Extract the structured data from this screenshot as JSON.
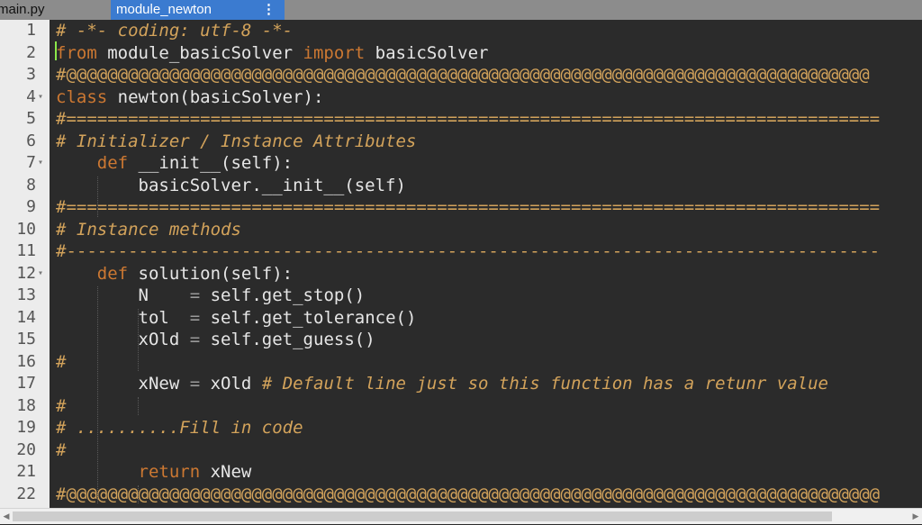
{
  "tabs": [
    {
      "label": "main.py",
      "active": false
    },
    {
      "label": "module_newton",
      "active": true
    }
  ],
  "tab_menu_icon": "⋮",
  "editor": {
    "lines": [
      {
        "n": "1",
        "fold": false,
        "tokens": [
          {
            "t": "# -*- coding: utf-8 -*-",
            "c": "cm"
          }
        ]
      },
      {
        "n": "2",
        "fold": false,
        "tokens": [
          {
            "t": "from",
            "c": "kw"
          },
          {
            "t": " module_basicSolver ",
            "c": ""
          },
          {
            "t": "import",
            "c": "kw"
          },
          {
            "t": " basicSolver",
            "c": ""
          }
        ]
      },
      {
        "n": "3",
        "fold": false,
        "tokens": [
          {
            "t": "#@@@@@@@@@@@@@@@@@@@@@@@@@@@@@@@@@@@@@@@@@@@@@@@@@@@@@@@@@@@@@@@@@@@@@@@@@@@@@@",
            "c": "cmn"
          }
        ]
      },
      {
        "n": "4",
        "fold": true,
        "tokens": [
          {
            "t": "class",
            "c": "kw"
          },
          {
            "t": " newton(basicSolver):",
            "c": ""
          }
        ]
      },
      {
        "n": "5",
        "fold": false,
        "tokens": [
          {
            "t": "#===============================================================================",
            "c": "cmn"
          }
        ]
      },
      {
        "n": "6",
        "fold": false,
        "tokens": [
          {
            "t": "# Initializer / Instance Attributes",
            "c": "cm"
          }
        ]
      },
      {
        "n": "7",
        "fold": true,
        "tokens": [
          {
            "t": "    ",
            "c": ""
          },
          {
            "t": "def",
            "c": "kw"
          },
          {
            "t": " __init__(self):",
            "c": ""
          }
        ]
      },
      {
        "n": "8",
        "fold": false,
        "tokens": [
          {
            "t": "        basicSolver.__init__(self)",
            "c": ""
          }
        ]
      },
      {
        "n": "9",
        "fold": false,
        "tokens": [
          {
            "t": "#===============================================================================",
            "c": "cmn"
          }
        ]
      },
      {
        "n": "10",
        "fold": false,
        "tokens": [
          {
            "t": "# Instance methods",
            "c": "cm"
          }
        ]
      },
      {
        "n": "11",
        "fold": false,
        "tokens": [
          {
            "t": "#-------------------------------------------------------------------------------",
            "c": "cmn"
          }
        ]
      },
      {
        "n": "12",
        "fold": true,
        "tokens": [
          {
            "t": "    ",
            "c": ""
          },
          {
            "t": "def",
            "c": "kw"
          },
          {
            "t": " solution(self):",
            "c": ""
          }
        ]
      },
      {
        "n": "13",
        "fold": false,
        "tokens": [
          {
            "t": "        N    ",
            "c": ""
          },
          {
            "t": "=",
            "c": "op"
          },
          {
            "t": " self.get_stop()",
            "c": ""
          }
        ]
      },
      {
        "n": "14",
        "fold": false,
        "tokens": [
          {
            "t": "        tol  ",
            "c": ""
          },
          {
            "t": "=",
            "c": "op"
          },
          {
            "t": " self.get_tolerance()",
            "c": ""
          }
        ]
      },
      {
        "n": "15",
        "fold": false,
        "tokens": [
          {
            "t": "        xOld ",
            "c": ""
          },
          {
            "t": "=",
            "c": "op"
          },
          {
            "t": " self.get_guess()",
            "c": ""
          }
        ]
      },
      {
        "n": "16",
        "fold": false,
        "tokens": [
          {
            "t": "#",
            "c": "cmn"
          }
        ]
      },
      {
        "n": "17",
        "fold": false,
        "tokens": [
          {
            "t": "        xNew ",
            "c": ""
          },
          {
            "t": "=",
            "c": "op"
          },
          {
            "t": " xOld ",
            "c": ""
          },
          {
            "t": "# Default line just so this function has a retunr value",
            "c": "cm"
          }
        ]
      },
      {
        "n": "18",
        "fold": false,
        "tokens": [
          {
            "t": "#",
            "c": "cmn"
          }
        ]
      },
      {
        "n": "19",
        "fold": false,
        "tokens": [
          {
            "t": "# ..........Fill in code",
            "c": "cm"
          }
        ]
      },
      {
        "n": "20",
        "fold": false,
        "tokens": [
          {
            "t": "#",
            "c": "cmn"
          }
        ]
      },
      {
        "n": "21",
        "fold": false,
        "tokens": [
          {
            "t": "        ",
            "c": ""
          },
          {
            "t": "return",
            "c": "kw"
          },
          {
            "t": " xNew",
            "c": ""
          }
        ]
      },
      {
        "n": "22",
        "fold": false,
        "tokens": [
          {
            "t": "#@@@@@@@@@@@@@@@@@@@@@@@@@@@@@@@@@@@@@@@@@@@@@@@@@@@@@@@@@@@@@@@@@@@@@@@@@@@@@@@",
            "c": "cmn"
          }
        ]
      }
    ]
  },
  "scrollbar": {
    "left_arrow": "◀",
    "right_arrow": "▶"
  }
}
